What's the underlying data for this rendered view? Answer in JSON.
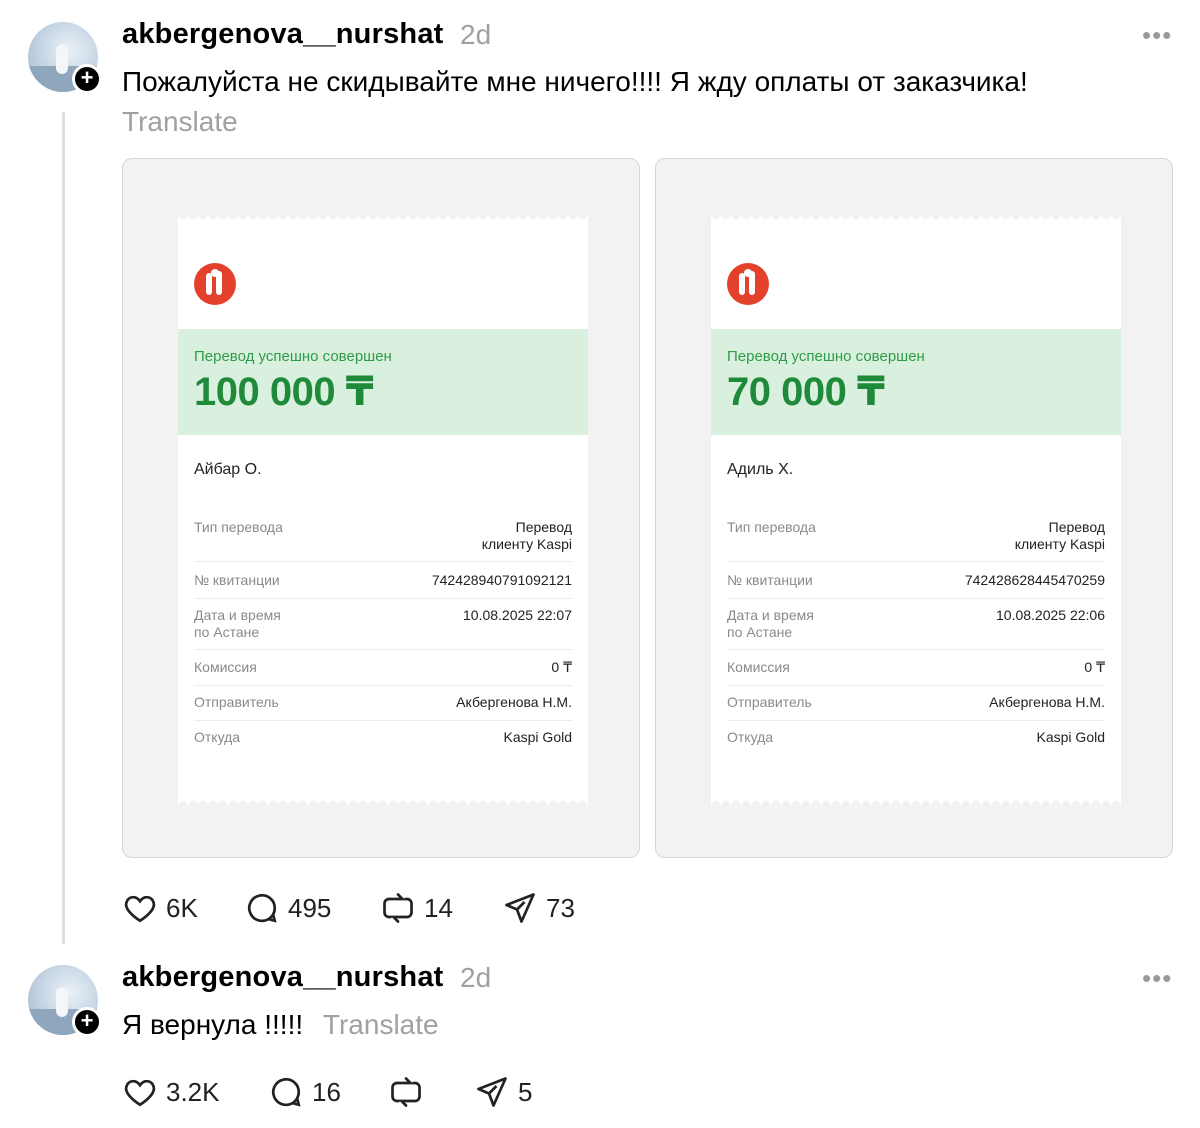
{
  "posts": [
    {
      "username": "akbergenova__nurshat",
      "time": "2d",
      "text": "Пожалуйста не скидывайте мне ничего!!!! Я жду оплаты от заказчика!",
      "translate": "Translate",
      "receipts": [
        {
          "status": "Перевод успешно совершен",
          "amount": "100 000 ₸",
          "recipient": "Айбар О.",
          "rows": [
            {
              "label": "Тип перевода",
              "value": "Перевод\nклиенту Kaspi"
            },
            {
              "label": "№ квитанции",
              "value": "742428940791092121"
            },
            {
              "label": "Дата и время\nпо Астане",
              "value": "10.08.2025 22:07"
            },
            {
              "label": "Комиссия",
              "value": "0 ₸"
            },
            {
              "label": "Отправитель",
              "value": "Акбергенова Н.М."
            },
            {
              "label": "Откуда",
              "value": "Kaspi Gold"
            }
          ]
        },
        {
          "status": "Перевод успешно совершен",
          "amount": "70 000 ₸",
          "recipient": "Адиль Х.",
          "rows": [
            {
              "label": "Тип перевода",
              "value": "Перевод\nклиенту Kaspi"
            },
            {
              "label": "№ квитанции",
              "value": "742428628445470259"
            },
            {
              "label": "Дата и время\nпо Астане",
              "value": "10.08.2025 22:06"
            },
            {
              "label": "Комиссия",
              "value": "0 ₸"
            },
            {
              "label": "Отправитель",
              "value": "Акбергенова Н.М."
            },
            {
              "label": "Откуда",
              "value": "Kaspi Gold"
            }
          ]
        }
      ],
      "actions": {
        "likes": "6K",
        "replies": "495",
        "reposts": "14",
        "shares": "73"
      }
    },
    {
      "username": "akbergenova__nurshat",
      "time": "2d",
      "text": "Я вернула !!!!!",
      "translate": "Translate",
      "actions": {
        "likes": "3.2K",
        "replies": "16",
        "reposts": "",
        "shares": "5"
      }
    }
  ],
  "icons": {
    "more": "more-horizontal-icon",
    "like": "heart-icon",
    "reply": "comment-icon",
    "repost": "repost-icon",
    "share": "send-icon",
    "follow": "plus-icon"
  },
  "colors": {
    "secondary_text": "#a0a0a0",
    "receipt_green_bg": "#d9f0df",
    "receipt_green_text": "#1f8a3a",
    "kaspi_red": "#e3412c"
  }
}
